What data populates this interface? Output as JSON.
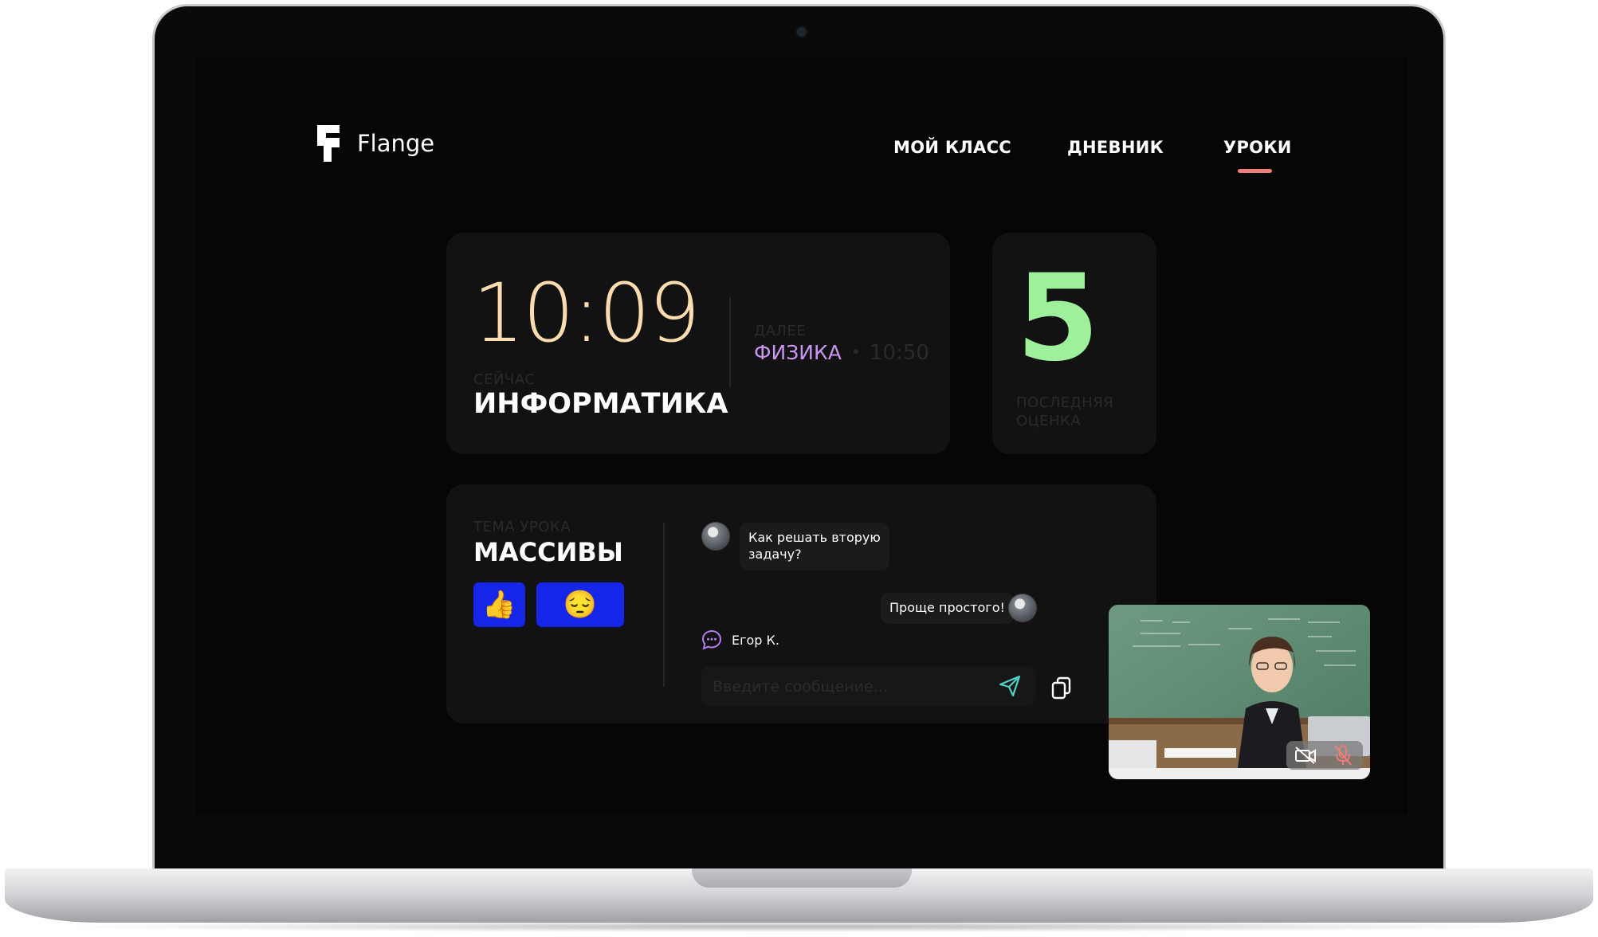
{
  "app": {
    "name": "Flange"
  },
  "nav": {
    "items": [
      {
        "label": "МОЙ КЛАСС"
      },
      {
        "label": "ДНЕВНИК"
      },
      {
        "label": "УРОКИ",
        "active": true
      }
    ]
  },
  "current": {
    "time": "10:09",
    "label": "СЕЙЧАС",
    "subject": "ИНФОРМАТИКА"
  },
  "next": {
    "label": "ДАЛЕЕ",
    "subject": "ФИЗИКА",
    "time": "10:50"
  },
  "grade": {
    "value": "5",
    "label_line1": "ПОСЛЕДНЯЯ",
    "label_line2": "ОЦЕНКА"
  },
  "topic": {
    "label": "ТЕМА УРОКА",
    "title": "МАССИВЫ",
    "reactions": [
      {
        "emoji": "👍"
      },
      {
        "emoji": "😔"
      }
    ]
  },
  "chat": {
    "messages": [
      {
        "text_line1": "Как решать вторую",
        "text_line2": "задачу?"
      },
      {
        "text": "Проще простого!"
      }
    ],
    "typing_user": "Егор К.",
    "input_placeholder": "Введите сообщение..."
  },
  "colors": {
    "accent_underline": "#f07d78",
    "time": "#fbdcae",
    "next_subject": "#c896f2",
    "grade": "#9ef09a",
    "reaction_button": "#1626e8"
  },
  "icons": [
    "flange-logo-icon",
    "send-icon",
    "copy-icon",
    "chat-bubble-icon",
    "camera-off-icon",
    "mic-off-icon"
  ]
}
